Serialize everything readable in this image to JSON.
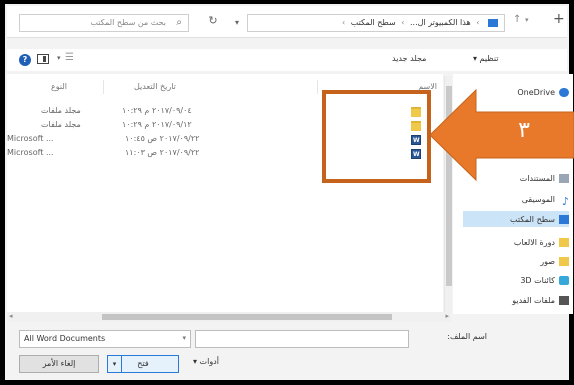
{
  "address_bar": {
    "search_placeholder": "بحث من سطح المكتب",
    "crumbs": [
      "هذا الكمبيوتر ال...",
      "سطح المكتب"
    ],
    "crumb_sep": "›"
  },
  "toolbar": {
    "organize_label": "تنظيم ▾",
    "new_folder_label": "مجلد جديد"
  },
  "columns": {
    "name": "الاسم",
    "date": "تاريخ التعديل",
    "type": "النوع"
  },
  "files": [
    {
      "name": "",
      "date": "٢٠١٧/٠٩/٠٤ م ١٠:٢٩",
      "type": "مجلد ملفات",
      "icon": "folder-icon"
    },
    {
      "name": "",
      "date": "٢٠١٧/٠٩/١٢ م ١٠:٢٩",
      "type": "مجلد ملفات",
      "icon": "folder-icon"
    },
    {
      "name": "",
      "date": "٢٠١٧/٠٩/٢٢ ص ١٠:٤٥",
      "type": "Microsoft ...",
      "icon": "word-icon"
    },
    {
      "name": "",
      "date": "٢٠١٧/٠٩/٢٢ ص ١١:٠٣",
      "type": "Microsoft ...",
      "icon": "word-icon"
    }
  ],
  "nav_items": [
    {
      "label": "OneDrive",
      "icon": "onedrive-icon",
      "color": "#2b78d6"
    },
    {
      "label": "المستندات",
      "icon": "documents-icon",
      "color": "#9aa6b5"
    },
    {
      "label": "الموسيقى",
      "icon": "music-icon",
      "color": "#2b78d6"
    },
    {
      "label": "سطح المكتب",
      "icon": "desktop-icon",
      "color": "#2b78d6",
      "selected": true
    },
    {
      "label": "دورة الالعاب",
      "icon": "folder-icon",
      "color": "#f0c94a"
    },
    {
      "label": "صور",
      "icon": "folder-icon",
      "color": "#f0c94a"
    },
    {
      "label": "كائنات 3D",
      "icon": "3d-objects-icon",
      "color": "#35a7d8"
    },
    {
      "label": "ملفات الفديو",
      "icon": "video-icon",
      "color": "#555555"
    }
  ],
  "bottom": {
    "filename_label": "اسم الملف:",
    "filename_value": "",
    "filetype_value": "All Word Documents",
    "tools_label": "أدوات ▾",
    "open_label": "فتح",
    "cancel_label": "إلغاء الأمر"
  },
  "callout": {
    "number": "٣",
    "color": "#e8792a"
  }
}
